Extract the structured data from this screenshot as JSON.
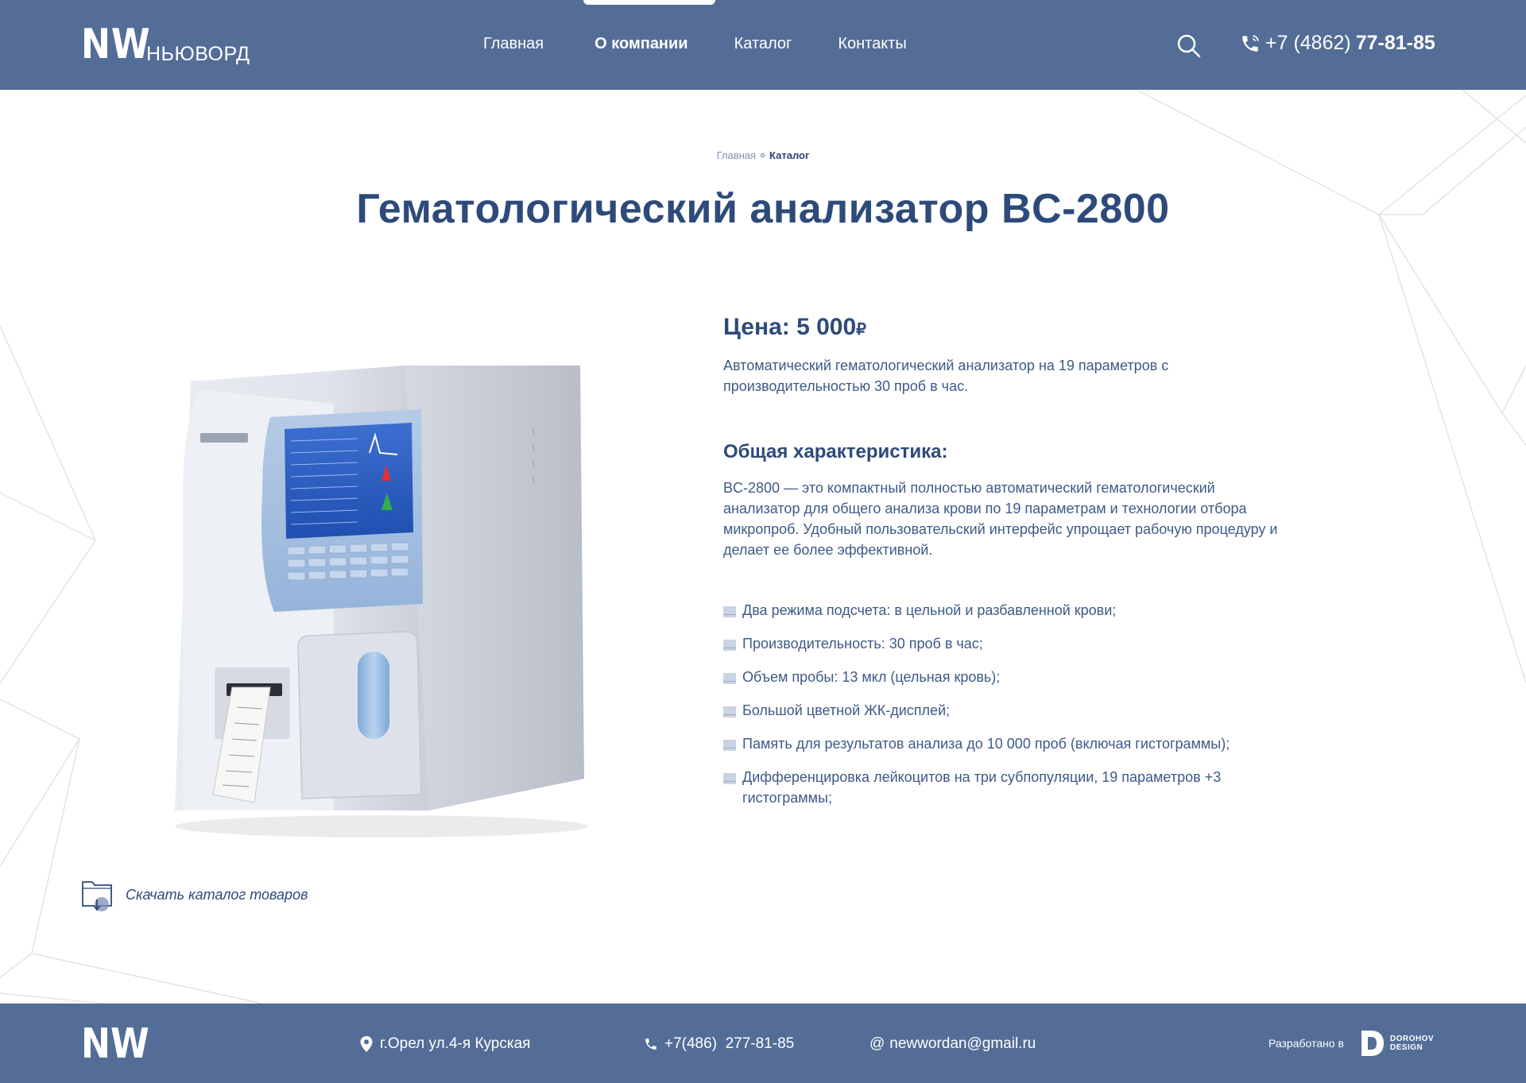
{
  "header": {
    "logo_mark": "NW",
    "logo_text": "НЬЮВОРД",
    "nav": [
      {
        "label": "Главная",
        "active": false
      },
      {
        "label": "О компании",
        "active": true
      },
      {
        "label": "Каталог",
        "active": false
      },
      {
        "label": "Контакты",
        "active": false
      }
    ],
    "search_icon": "search-icon",
    "phone_prefix": "+7 (4862)",
    "phone_main": "77-81-85"
  },
  "breadcrumb": {
    "home": "Главная",
    "current": "Каталог"
  },
  "product": {
    "title": "Гематологический анализатор BC-2800",
    "price_label": "Цена: 5 000",
    "currency": "₽",
    "short_description": "Автоматический гематологический анализатор на 19 параметров с производительностью 30 проб в час.",
    "section_heading": "Общая характеристика:",
    "long_description": "BC-2800 — это компактный полностью автоматический гематологический анализатор для общего анализа крови по 19 параметрам и технологии отбора микропроб. Удобный пользовательский интерфейс упрощает рабочую процедуру и делает ее более эффективной.",
    "features": [
      "Два режима подсчета: в цельной и разбавленной крови;",
      "Производительность: 30 проб в час;",
      "Объем пробы: 13 мкл (цельная кровь);",
      "Большой цветной ЖК-дисплей;",
      "Память для результатов анализа до 10 000 проб (включая гистограммы);",
      "Дифференцировка лейкоцитов на три субпопуляции, 19 параметров +3 гистограммы;"
    ]
  },
  "download": {
    "label": "Скачать каталог товаров",
    "icon": "folder-download-icon"
  },
  "footer": {
    "logo_mark": "NW",
    "address": "г.Орел ул.4-я Курская",
    "phone": "+7(486)  277-81-85",
    "email": "newwordan@gmail.ru",
    "dev_label": "Разработано в",
    "dev_name_line1": "DOROHOV",
    "dev_name_line2": "DESIGN"
  },
  "colors": {
    "header_bg": "#536d97",
    "title": "#2d4a7a",
    "text": "#3d5a86"
  }
}
